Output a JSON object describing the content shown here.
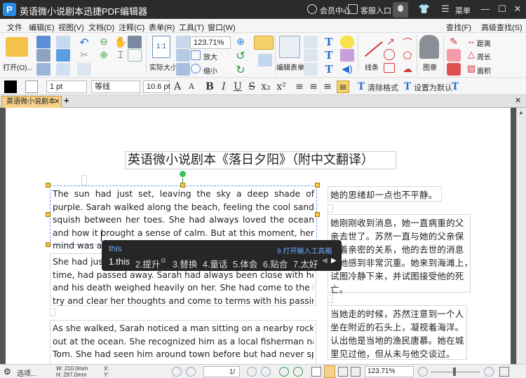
{
  "titlebar": {
    "app_title": "英语微小说剧本迅捷PDF编辑器",
    "member_center": "会员中心",
    "client_login": "客服入口",
    "menu_label": "菜单"
  },
  "menubar": {
    "items": [
      "文件",
      "编辑(E)",
      "视图(V)",
      "文档(D)",
      "注释(C)",
      "表单(R)",
      "工具(T)",
      "窗口(W)"
    ],
    "find": "查找(F)",
    "advanced_find": "高级查找(S)"
  },
  "ribbon": {
    "open_label": "打开(O)...",
    "zoom_value": "123.71%",
    "actual_size_label": "实际大小",
    "zoom_in_label": "放大",
    "zoom_out_label": "缩小",
    "edit_form_label": "编辑表单",
    "line_label": "线条",
    "stamp_label": "图章",
    "distance_label": "距离",
    "perimeter_label": "周长",
    "area_label": "面积"
  },
  "format_bar": {
    "line_width": "1 pt",
    "font_name": "等线",
    "font_size": "10.6 pt",
    "clear_format": "清除格式",
    "set_default": "设置为默认"
  },
  "tabs": {
    "document_tab": "英语微小说剧本"
  },
  "document": {
    "title": "英语微小说剧本《落日夕阳》（附中文翻译）",
    "en_paragraph_1": "The sun had just set, leaving the sky a deep shade of purple. Sarah walked along the beach, feeling the cool sand squish between her toes. She had always loved the ocean and how it brought a sense of calm. But at this moment, her mind was anything but calm.",
    "en_paragraph_2_lines": [
      "She had just received news that her father, who had been ill for some",
      "time, had passed away. Sarah had always been close with her father,",
      "and his death weighed heavily on her. She had come to the beach to",
      "try and clear her thoughts and come to terms with his passing."
    ],
    "en_paragraph_3_lines": [
      "As she walked, Sarah noticed a man sitting on a nearby rock, staring",
      "out at the ocean. She recognized him as a local fisherman named",
      "Tom. She had seen him around town before but had never spoken"
    ],
    "zh_paragraph_1": "她的思绪却一点也不平静。",
    "zh_paragraph_2_lines": [
      "她刚刚收到消息，她一直病重的父",
      "亲去世了。苏然一直与她的父亲保",
      "持着亲密的关系，他的去世的消息",
      "让她感到非常沉重。她来到海滩上，",
      "试图冷静下来，并试图接受他的死",
      "亡。"
    ],
    "zh_paragraph_3_lines": [
      "当她走的时候，苏然注意到一个人",
      "坐在附近的石头上，凝视着海洋。她",
      "认出他是当地的渔民唐慕。她在城",
      "里见过他，但从未与他交谈过。"
    ]
  },
  "ime": {
    "input": "this",
    "toolbox_hint": "9.打开输入工具箱",
    "candidates": [
      "1.this",
      "2.提升",
      "3.替换",
      "4.童话",
      "5.体会",
      "6.贴合",
      "7.太好"
    ]
  },
  "statusbar": {
    "options": "选项...",
    "width": "W: 210.0mm",
    "height": "H: 297.0mm",
    "x": "X:",
    "y": "Y:",
    "page_indicator": "1/",
    "zoom": "123.71%"
  },
  "colors": {
    "titlebar": "#2b2b2b",
    "accent": "#2a8ae6",
    "tab": "#f7d08a",
    "handle": "#f5c542"
  }
}
